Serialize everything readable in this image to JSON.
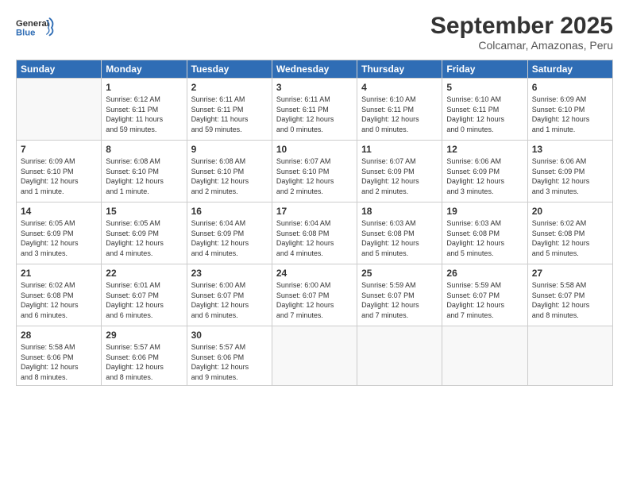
{
  "logo": {
    "line1": "General",
    "line2": "Blue"
  },
  "title": "September 2025",
  "subtitle": "Colcamar, Amazonas, Peru",
  "weekdays": [
    "Sunday",
    "Monday",
    "Tuesday",
    "Wednesday",
    "Thursday",
    "Friday",
    "Saturday"
  ],
  "weeks": [
    [
      {
        "day": "",
        "info": ""
      },
      {
        "day": "1",
        "info": "Sunrise: 6:12 AM\nSunset: 6:11 PM\nDaylight: 11 hours\nand 59 minutes."
      },
      {
        "day": "2",
        "info": "Sunrise: 6:11 AM\nSunset: 6:11 PM\nDaylight: 11 hours\nand 59 minutes."
      },
      {
        "day": "3",
        "info": "Sunrise: 6:11 AM\nSunset: 6:11 PM\nDaylight: 12 hours\nand 0 minutes."
      },
      {
        "day": "4",
        "info": "Sunrise: 6:10 AM\nSunset: 6:11 PM\nDaylight: 12 hours\nand 0 minutes."
      },
      {
        "day": "5",
        "info": "Sunrise: 6:10 AM\nSunset: 6:11 PM\nDaylight: 12 hours\nand 0 minutes."
      },
      {
        "day": "6",
        "info": "Sunrise: 6:09 AM\nSunset: 6:10 PM\nDaylight: 12 hours\nand 1 minute."
      }
    ],
    [
      {
        "day": "7",
        "info": "Sunrise: 6:09 AM\nSunset: 6:10 PM\nDaylight: 12 hours\nand 1 minute."
      },
      {
        "day": "8",
        "info": "Sunrise: 6:08 AM\nSunset: 6:10 PM\nDaylight: 12 hours\nand 1 minute."
      },
      {
        "day": "9",
        "info": "Sunrise: 6:08 AM\nSunset: 6:10 PM\nDaylight: 12 hours\nand 2 minutes."
      },
      {
        "day": "10",
        "info": "Sunrise: 6:07 AM\nSunset: 6:10 PM\nDaylight: 12 hours\nand 2 minutes."
      },
      {
        "day": "11",
        "info": "Sunrise: 6:07 AM\nSunset: 6:09 PM\nDaylight: 12 hours\nand 2 minutes."
      },
      {
        "day": "12",
        "info": "Sunrise: 6:06 AM\nSunset: 6:09 PM\nDaylight: 12 hours\nand 3 minutes."
      },
      {
        "day": "13",
        "info": "Sunrise: 6:06 AM\nSunset: 6:09 PM\nDaylight: 12 hours\nand 3 minutes."
      }
    ],
    [
      {
        "day": "14",
        "info": "Sunrise: 6:05 AM\nSunset: 6:09 PM\nDaylight: 12 hours\nand 3 minutes."
      },
      {
        "day": "15",
        "info": "Sunrise: 6:05 AM\nSunset: 6:09 PM\nDaylight: 12 hours\nand 4 minutes."
      },
      {
        "day": "16",
        "info": "Sunrise: 6:04 AM\nSunset: 6:09 PM\nDaylight: 12 hours\nand 4 minutes."
      },
      {
        "day": "17",
        "info": "Sunrise: 6:04 AM\nSunset: 6:08 PM\nDaylight: 12 hours\nand 4 minutes."
      },
      {
        "day": "18",
        "info": "Sunrise: 6:03 AM\nSunset: 6:08 PM\nDaylight: 12 hours\nand 5 minutes."
      },
      {
        "day": "19",
        "info": "Sunrise: 6:03 AM\nSunset: 6:08 PM\nDaylight: 12 hours\nand 5 minutes."
      },
      {
        "day": "20",
        "info": "Sunrise: 6:02 AM\nSunset: 6:08 PM\nDaylight: 12 hours\nand 5 minutes."
      }
    ],
    [
      {
        "day": "21",
        "info": "Sunrise: 6:02 AM\nSunset: 6:08 PM\nDaylight: 12 hours\nand 6 minutes."
      },
      {
        "day": "22",
        "info": "Sunrise: 6:01 AM\nSunset: 6:07 PM\nDaylight: 12 hours\nand 6 minutes."
      },
      {
        "day": "23",
        "info": "Sunrise: 6:00 AM\nSunset: 6:07 PM\nDaylight: 12 hours\nand 6 minutes."
      },
      {
        "day": "24",
        "info": "Sunrise: 6:00 AM\nSunset: 6:07 PM\nDaylight: 12 hours\nand 7 minutes."
      },
      {
        "day": "25",
        "info": "Sunrise: 5:59 AM\nSunset: 6:07 PM\nDaylight: 12 hours\nand 7 minutes."
      },
      {
        "day": "26",
        "info": "Sunrise: 5:59 AM\nSunset: 6:07 PM\nDaylight: 12 hours\nand 7 minutes."
      },
      {
        "day": "27",
        "info": "Sunrise: 5:58 AM\nSunset: 6:07 PM\nDaylight: 12 hours\nand 8 minutes."
      }
    ],
    [
      {
        "day": "28",
        "info": "Sunrise: 5:58 AM\nSunset: 6:06 PM\nDaylight: 12 hours\nand 8 minutes."
      },
      {
        "day": "29",
        "info": "Sunrise: 5:57 AM\nSunset: 6:06 PM\nDaylight: 12 hours\nand 8 minutes."
      },
      {
        "day": "30",
        "info": "Sunrise: 5:57 AM\nSunset: 6:06 PM\nDaylight: 12 hours\nand 9 minutes."
      },
      {
        "day": "",
        "info": ""
      },
      {
        "day": "",
        "info": ""
      },
      {
        "day": "",
        "info": ""
      },
      {
        "day": "",
        "info": ""
      }
    ]
  ]
}
